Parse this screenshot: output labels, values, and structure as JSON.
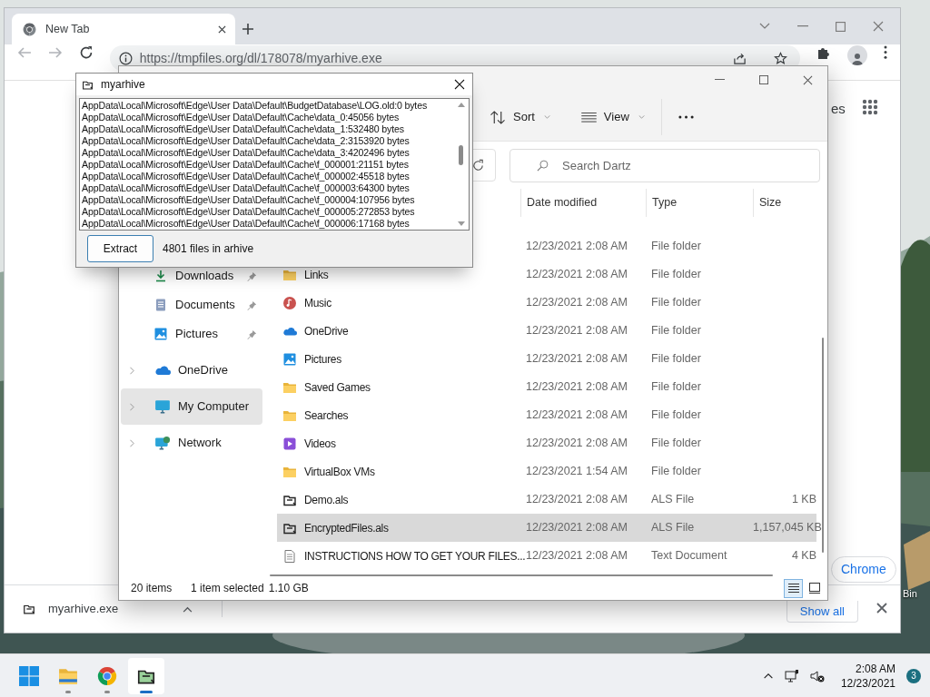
{
  "browser": {
    "tab": {
      "title": "New Tab",
      "selected": true
    },
    "url": "https://tmpfiles.org/dl/178078/myarhive.exe",
    "page_fragment": "es",
    "page_link": "Chrome",
    "download_bar": {
      "file": "myarhive.exe",
      "button": "Show all"
    }
  },
  "explorer": {
    "toolbar": [
      {
        "label": "Sort",
        "kind": "sort"
      },
      {
        "label": "View",
        "kind": "view"
      }
    ],
    "search_placeholder": "Search Dartz",
    "nav": [
      {
        "label": "Downloads",
        "kind": "download",
        "pinned": true,
        "selected": false
      },
      {
        "label": "Documents",
        "kind": "documents",
        "pinned": true,
        "selected": false
      },
      {
        "label": "Pictures",
        "kind": "pictures",
        "pinned": true,
        "selected": false
      },
      {
        "label": "OneDrive",
        "kind": "onedrive",
        "pinned": false,
        "selected": false
      },
      {
        "label": "My Computer",
        "kind": "computer",
        "pinned": false,
        "selected": true
      },
      {
        "label": "Network",
        "kind": "network",
        "pinned": false,
        "selected": false
      }
    ],
    "columns": [
      "Date modified",
      "Type",
      "Size"
    ],
    "files": [
      {
        "date": "12/23/2021 2:08 AM",
        "type": "File folder",
        "selected": false
      },
      {
        "name": "Links",
        "kind": "folder",
        "date": "12/23/2021 2:08 AM",
        "type": "File folder",
        "selected": false
      },
      {
        "name": "Music",
        "kind": "music",
        "date": "12/23/2021 2:08 AM",
        "type": "File folder",
        "selected": false
      },
      {
        "name": "OneDrive",
        "kind": "onedrive",
        "date": "12/23/2021 2:08 AM",
        "type": "File folder",
        "selected": false
      },
      {
        "name": "Pictures",
        "kind": "pictures",
        "date": "12/23/2021 2:08 AM",
        "type": "File folder",
        "selected": false
      },
      {
        "name": "Saved Games",
        "kind": "folder",
        "date": "12/23/2021 2:08 AM",
        "type": "File folder",
        "selected": false
      },
      {
        "name": "Searches",
        "kind": "folder",
        "date": "12/23/2021 2:08 AM",
        "type": "File folder",
        "selected": false
      },
      {
        "name": "Videos",
        "kind": "videos",
        "date": "12/23/2021 2:08 AM",
        "type": "File folder",
        "selected": false
      },
      {
        "name": "VirtualBox VMs",
        "kind": "folder",
        "date": "12/23/2021 1:54 AM",
        "type": "File folder",
        "selected": false
      },
      {
        "name": "Demo.als",
        "kind": "archive",
        "date": "12/23/2021 2:08 AM",
        "type": "ALS File",
        "size": "1 KB",
        "selected": false
      },
      {
        "name": "EncryptedFiles.als",
        "kind": "archive",
        "date": "12/23/2021 2:08 AM",
        "type": "ALS File",
        "size": "1,157,045 KB",
        "selected": true
      },
      {
        "name": "INSTRUCTIONS HOW TO GET YOUR FILES...",
        "kind": "text",
        "date": "12/23/2021 2:08 AM",
        "type": "Text Document",
        "size": "4 KB",
        "selected": false
      }
    ],
    "status": {
      "count": "20 items",
      "selection": "1 item selected",
      "size": "1.10 GB"
    },
    "view_modes": [
      {
        "kind": "details",
        "selected": true
      },
      {
        "kind": "tiles",
        "selected": false
      }
    ]
  },
  "dialog": {
    "title": "myarhive",
    "lines": [
      "AppData\\Local\\Microsoft\\Edge\\User Data\\Default\\BudgetDatabase\\LOG.old:0 bytes",
      "AppData\\Local\\Microsoft\\Edge\\User Data\\Default\\Cache\\data_0:45056 bytes",
      "AppData\\Local\\Microsoft\\Edge\\User Data\\Default\\Cache\\data_1:532480 bytes",
      "AppData\\Local\\Microsoft\\Edge\\User Data\\Default\\Cache\\data_2:3153920 bytes",
      "AppData\\Local\\Microsoft\\Edge\\User Data\\Default\\Cache\\data_3:4202496 bytes",
      "AppData\\Local\\Microsoft\\Edge\\User Data\\Default\\Cache\\f_000001:21151 bytes",
      "AppData\\Local\\Microsoft\\Edge\\User Data\\Default\\Cache\\f_000002:45518 bytes",
      "AppData\\Local\\Microsoft\\Edge\\User Data\\Default\\Cache\\f_000003:64300 bytes",
      "AppData\\Local\\Microsoft\\Edge\\User Data\\Default\\Cache\\f_000004:107956 bytes",
      "AppData\\Local\\Microsoft\\Edge\\User Data\\Default\\Cache\\f_000005:272853 bytes",
      "AppData\\Local\\Microsoft\\Edge\\User Data\\Default\\Cache\\f_000006:17168 bytes"
    ],
    "button": "Extract",
    "summary": "4801 files in arhive"
  },
  "desktop": {
    "icon_label": "Bin"
  },
  "taskbar": {
    "apps": [
      {
        "kind": "start",
        "running": false,
        "active": false
      },
      {
        "kind": "explorer",
        "running": true,
        "active": false
      },
      {
        "kind": "chrome",
        "running": true,
        "active": false
      },
      {
        "kind": "archiver",
        "running": true,
        "active": true
      }
    ],
    "time": "2:08 AM",
    "date": "12/23/2021",
    "notifications": "3"
  }
}
